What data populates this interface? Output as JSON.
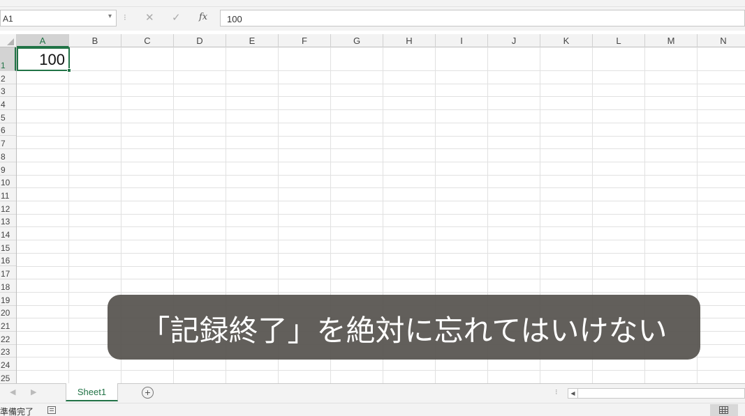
{
  "formula_bar": {
    "name_box": "A1",
    "name_box_arrow": "▾",
    "separator": "⁝",
    "cancel_icon": "✕",
    "enter_icon": "✓",
    "fx_icon": "fx",
    "formula_value": "100"
  },
  "columns": [
    "A",
    "B",
    "C",
    "D",
    "E",
    "F",
    "G",
    "H",
    "I",
    "J",
    "K",
    "L",
    "M",
    "N"
  ],
  "rows": [
    "1",
    "2",
    "3",
    "4",
    "5",
    "6",
    "7",
    "8",
    "9",
    "10",
    "11",
    "12",
    "13",
    "14",
    "15",
    "16",
    "17",
    "18",
    "19",
    "20",
    "21",
    "22",
    "23",
    "24",
    "25"
  ],
  "selected_cell": {
    "column": "A",
    "row": "1",
    "value": "100"
  },
  "subtitle": "「記録終了」を絶対に忘れてはいけない",
  "sheet_tabs": {
    "nav_prev": "◀",
    "nav_next": "▶",
    "active_sheet": "Sheet1",
    "add_sheet": "+",
    "scroll_dots": "⁝",
    "scroll_left": "◀"
  },
  "status_bar": {
    "status": "準備完了",
    "macro_icon": "macro-record-icon",
    "view_icon": "normal-view-icon"
  },
  "colors": {
    "accent": "#217346",
    "subtitle_bg": "#55514d"
  }
}
